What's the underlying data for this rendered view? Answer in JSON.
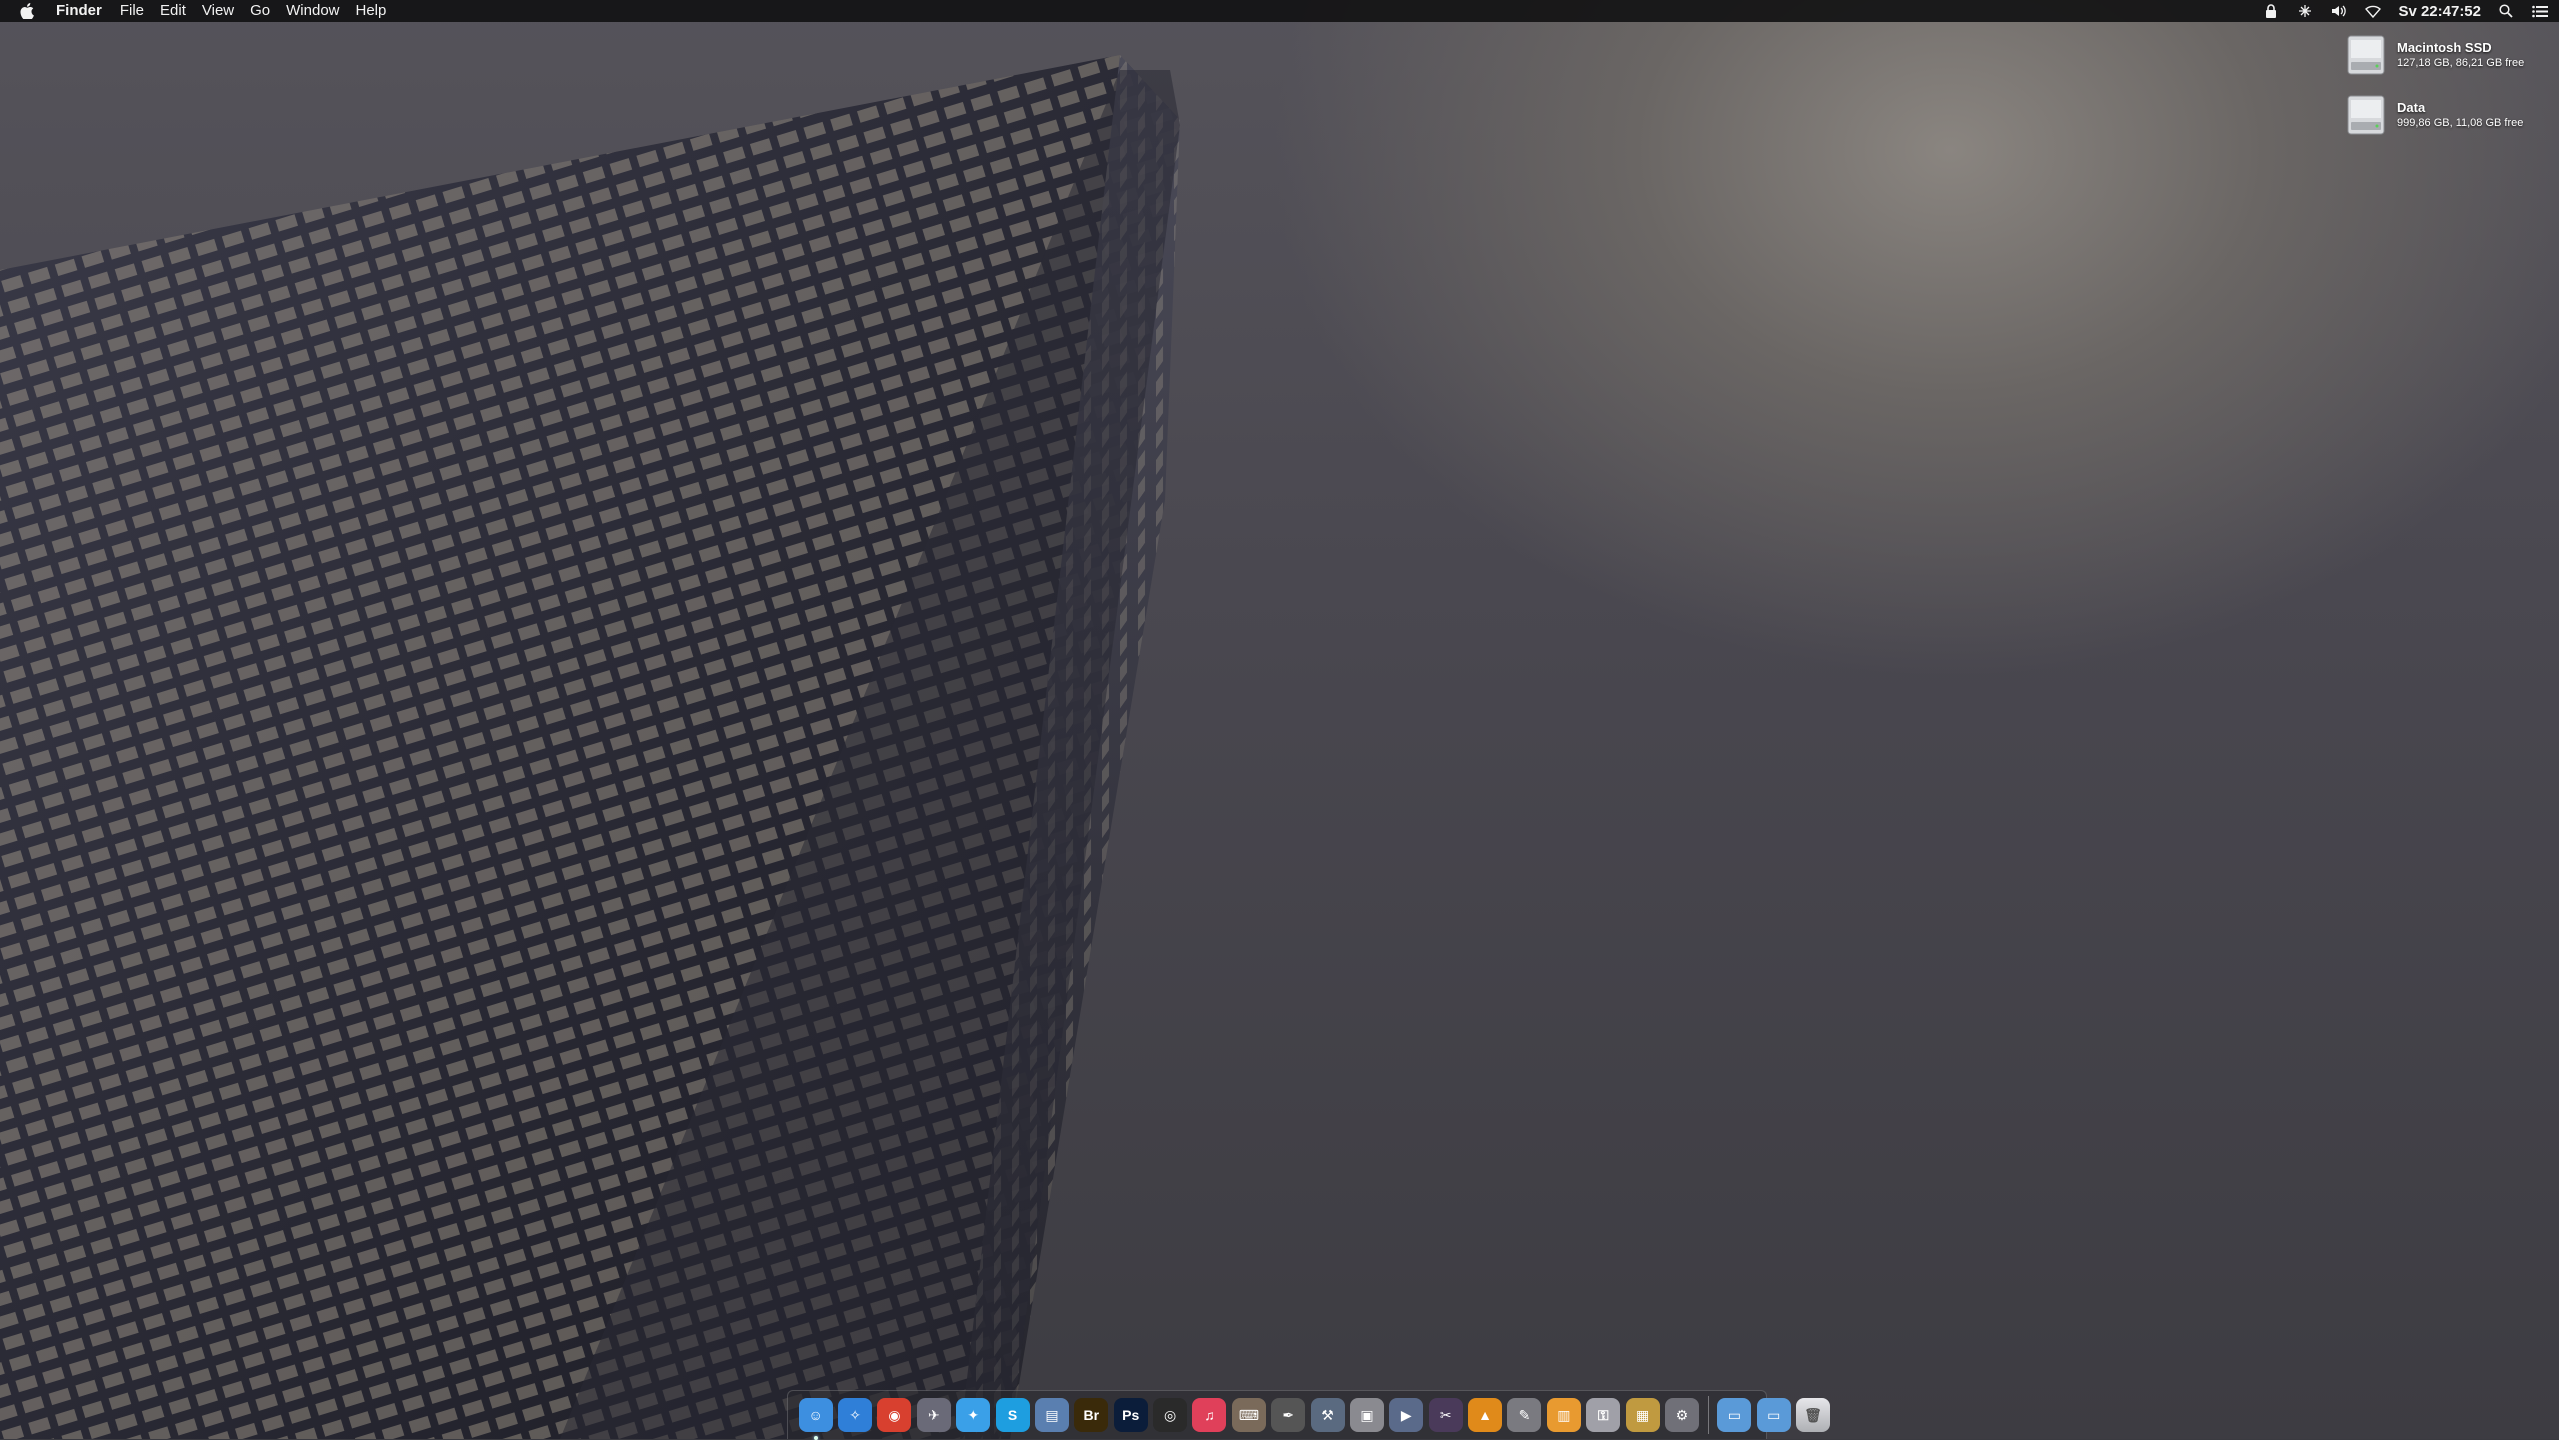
{
  "menubar": {
    "apple_icon": "apple-icon",
    "app_name": "Finder",
    "menus": [
      "File",
      "Edit",
      "View",
      "Go",
      "Window",
      "Help"
    ],
    "status_icons": [
      "lock-icon",
      "network-icon",
      "volume-icon",
      "wifi-icon"
    ],
    "clock": "Sv 22:47:52",
    "right_icons": [
      "spotlight-icon",
      "notification-center-icon"
    ]
  },
  "desktop_disks": [
    {
      "name": "Macintosh SSD",
      "info": "127,18 GB, 86,21 GB free",
      "icon": "hard-drive-icon"
    },
    {
      "name": "Data",
      "info": "999,86 GB, 11,08 GB free",
      "icon": "hard-drive-icon"
    }
  ],
  "dock": {
    "apps": [
      {
        "name": "finder",
        "color": "#3d8fe0",
        "glyph": "☺",
        "running": true
      },
      {
        "name": "safari",
        "color": "#2f7fd8",
        "glyph": "✧",
        "running": false
      },
      {
        "name": "chrome",
        "color": "#d8402f",
        "glyph": "◉",
        "running": false
      },
      {
        "name": "tweetbot",
        "color": "#6a6a78",
        "glyph": "✈",
        "running": false
      },
      {
        "name": "twitter",
        "color": "#3aa0e8",
        "glyph": "✦",
        "running": false
      },
      {
        "name": "skype",
        "color": "#1e9ee0",
        "glyph": "S",
        "running": false
      },
      {
        "name": "preview",
        "color": "#5a7fb0",
        "glyph": "▤",
        "running": false
      },
      {
        "name": "bridge",
        "color": "#3a2a0a",
        "glyph": "Br",
        "running": false
      },
      {
        "name": "photoshop",
        "color": "#0b1d3a",
        "glyph": "Ps",
        "running": false
      },
      {
        "name": "aperture",
        "color": "#2a2a2a",
        "glyph": "◎",
        "running": false
      },
      {
        "name": "itunes",
        "color": "#e0405a",
        "glyph": "♫",
        "running": false
      },
      {
        "name": "keyboard-maestro",
        "color": "#7a6a5a",
        "glyph": "⌨",
        "running": false
      },
      {
        "name": "utility",
        "color": "#555",
        "glyph": "✒",
        "running": false
      },
      {
        "name": "xcode",
        "color": "#5a6a80",
        "glyph": "⚒",
        "running": false
      },
      {
        "name": "system-info",
        "color": "#8a8a90",
        "glyph": "▣",
        "running": false
      },
      {
        "name": "imovie",
        "color": "#5a6a8a",
        "glyph": "▶",
        "running": false
      },
      {
        "name": "final-cut",
        "color": "#4a3a5a",
        "glyph": "✂",
        "running": false
      },
      {
        "name": "vlc",
        "color": "#e08a1a",
        "glyph": "▲",
        "running": false
      },
      {
        "name": "script-editor",
        "color": "#7a7a80",
        "glyph": "✎",
        "running": false
      },
      {
        "name": "ibooks",
        "color": "#e89a30",
        "glyph": "▥",
        "running": false
      },
      {
        "name": "keychain",
        "color": "#a0a0a8",
        "glyph": "⚿",
        "running": false
      },
      {
        "name": "archive-utility",
        "color": "#c09a40",
        "glyph": "▦",
        "running": false
      },
      {
        "name": "system-preferences",
        "color": "#707078",
        "glyph": "⚙",
        "running": false
      }
    ],
    "folders": [
      {
        "name": "applications-folder",
        "color": "#5a9ad8",
        "glyph": "▭"
      },
      {
        "name": "downloads-folder",
        "color": "#5a9ad8",
        "glyph": "▭"
      }
    ],
    "trash": {
      "name": "trash",
      "color": "#c8c8cc",
      "glyph": "🗑"
    }
  }
}
